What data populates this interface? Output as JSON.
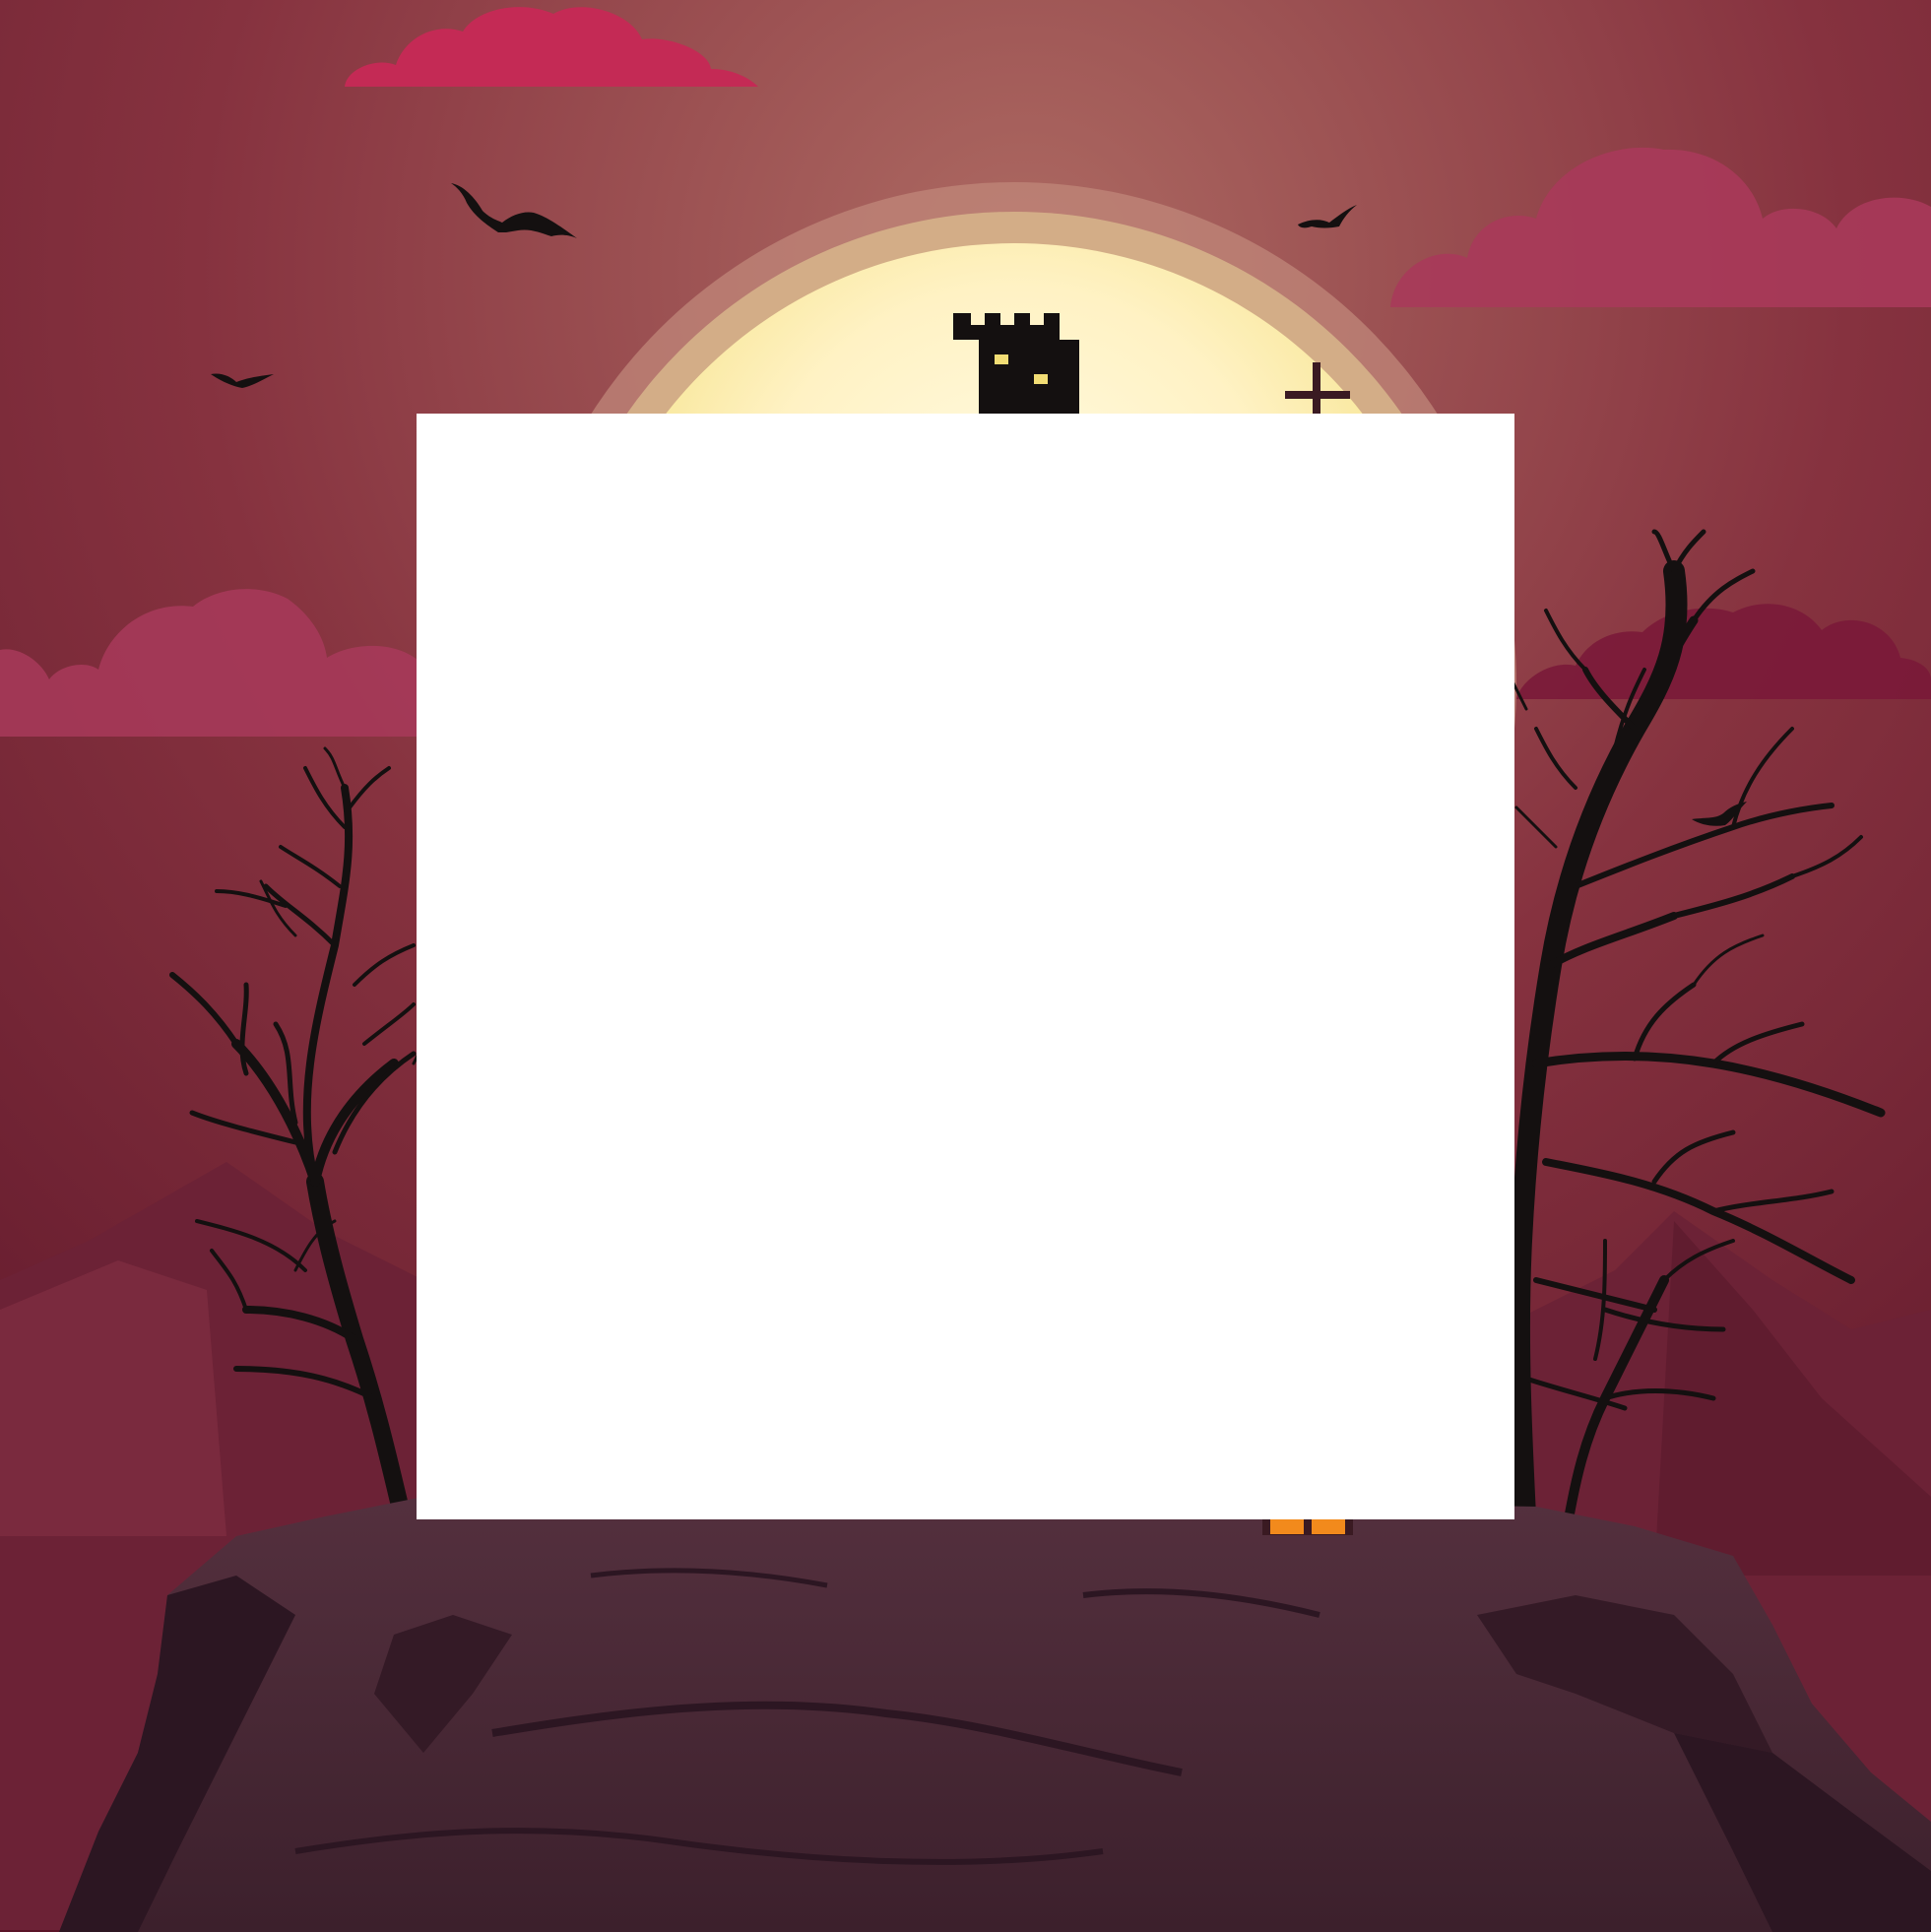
{
  "scene": {
    "theme": "halloween-night",
    "colors": {
      "sky_center": "#ad6a62",
      "sky_edge": "#5a1428",
      "moon_glow_outer": "#c0877a",
      "moon_glow_inner": "#d6b28a",
      "moon_center": "#fff2c4",
      "moon_edge": "#f2dd75",
      "cloud": "#a83a5a",
      "cloud_bright": "#c42a55",
      "mountain": "#7a2a3e",
      "cliff_top": "#4e2a38",
      "cliff_shade": "#2c1622",
      "silhouette": "#141010",
      "window_glow": "#f28a1c",
      "panel": "#ffffff"
    },
    "elements": [
      "moon",
      "castle-tower",
      "grave-cross",
      "bat",
      "cloud",
      "dead-tree",
      "mountain",
      "rocky-cliff",
      "blank-panel"
    ]
  }
}
